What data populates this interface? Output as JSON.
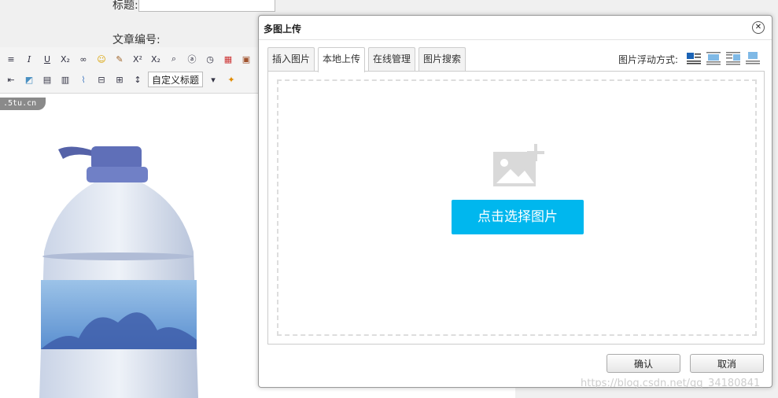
{
  "page": {
    "title_label": "标题:",
    "article_no_label": "文章编号:",
    "url_tag": ".5tu.cn"
  },
  "toolbar": {
    "row1_icons": [
      "align-icon",
      "italic-icon",
      "underline-icon",
      "subscript-icon",
      "link-icon",
      "emoticon-icon",
      "brush-icon",
      "superscript-icon",
      "subscript2-icon",
      "search-icon",
      "anchor-icon",
      "clock-icon",
      "calendar-icon",
      "image-icon"
    ],
    "row2_icons": [
      "indent-icon",
      "insert-image-icon",
      "grid-icon",
      "table-icon",
      "attachment-icon",
      "pagebreak-icon",
      "template-icon",
      "line-height-icon"
    ],
    "custom_heading": "自定义标题"
  },
  "dialog": {
    "title": "多图上传",
    "close_glyph": "✕",
    "tabs": [
      {
        "label": "插入图片",
        "active": false
      },
      {
        "label": "本地上传",
        "active": true
      },
      {
        "label": "在线管理",
        "active": false
      },
      {
        "label": "图片搜索",
        "active": false
      }
    ],
    "float_label": "图片浮动方式:",
    "float_options": [
      "float-none-icon",
      "float-left-icon",
      "float-right-icon",
      "float-center-icon"
    ],
    "choose_button": "点击选择图片",
    "confirm_button": "确认",
    "cancel_button": "取消",
    "accent_color": "#00b7ee"
  },
  "watermark": "https://blog.csdn.net/qq_34180841"
}
